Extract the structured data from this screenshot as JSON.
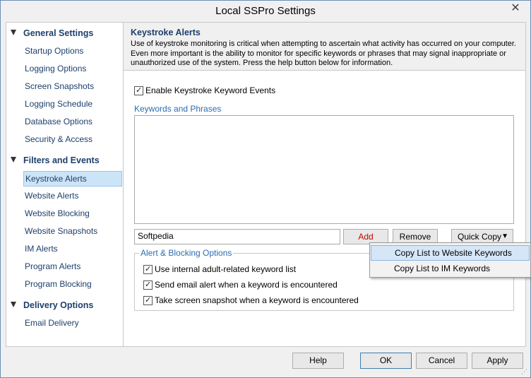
{
  "window": {
    "title": "Local SSPro Settings",
    "close_symbol": "✕"
  },
  "sidebar": {
    "groups": [
      {
        "label": "General Settings",
        "items": [
          "Startup Options",
          "Logging Options",
          "Screen Snapshots",
          "Logging Schedule",
          "Database Options",
          "Security & Access"
        ]
      },
      {
        "label": "Filters and Events",
        "items": [
          "Keystroke Alerts",
          "Website Alerts",
          "Website Blocking",
          "Website Snapshots",
          "IM Alerts",
          "Program Alerts",
          "Program Blocking"
        ]
      },
      {
        "label": "Delivery Options",
        "items": [
          "Email Delivery"
        ]
      }
    ],
    "selected_item": "Keystroke Alerts"
  },
  "header": {
    "title": "Keystroke Alerts",
    "description": "Use of keystroke monitoring is critical when attempting to ascertain what activity has occurred on your computer. Even more important is the ability to monitor for specific keywords or phrases that may signal inappropriate or unauthorized use of the system. Press the help button below for information."
  },
  "main": {
    "enable_label": "Enable Keystroke Keyword Events",
    "enable_checked": true,
    "keywords_label": "Keywords and Phrases",
    "keyword_input_value": "Softpedia",
    "add_label": "Add",
    "remove_label": "Remove",
    "quick_copy_label": "Quick Copy",
    "options_title": "Alert & Blocking Options",
    "options": [
      {
        "label": "Use internal adult-related keyword list",
        "checked": true
      },
      {
        "label": "Send email alert when a keyword is encountered",
        "checked": true
      },
      {
        "label": "Take screen snapshot when a keyword is encountered",
        "checked": true
      }
    ]
  },
  "quick_copy_menu": {
    "items": [
      "Copy List to Website Keywords",
      "Copy List to IM Keywords"
    ],
    "highlighted": "Copy List to Website Keywords"
  },
  "footer": {
    "help_label": "Help",
    "ok_label": "OK",
    "cancel_label": "Cancel",
    "apply_label": "Apply"
  },
  "icons": {
    "check": "✓",
    "chevron": "▼",
    "grip": "⋰"
  },
  "colors": {
    "accent_text": "#1e3f6b",
    "link_blue": "#2b6cb0",
    "selection_bg": "#cce4f7",
    "add_red": "#cc0000"
  }
}
